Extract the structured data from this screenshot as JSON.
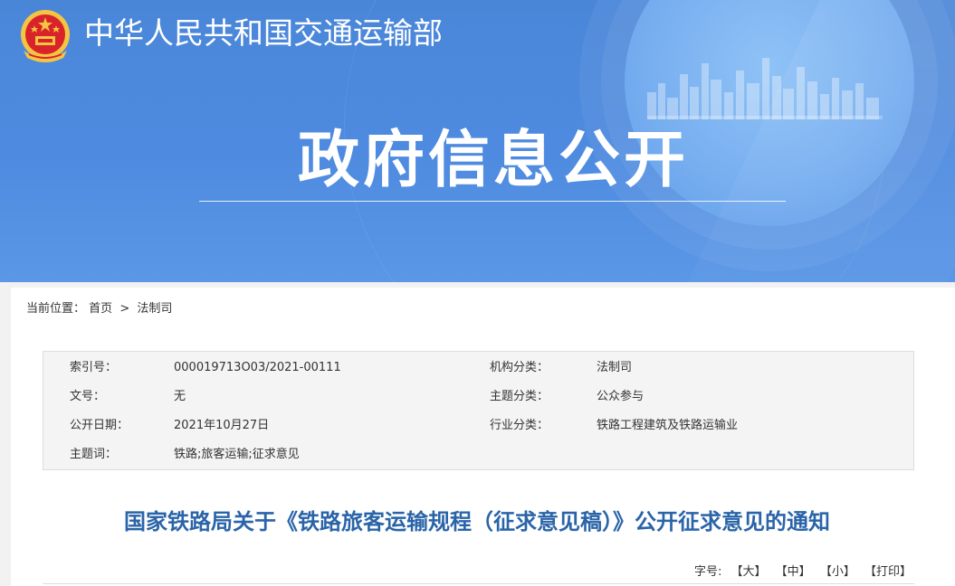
{
  "header": {
    "ministry_name": "中华人民共和国交通运输部",
    "banner_title": "政府信息公开",
    "emblem_icon": "national-emblem-icon"
  },
  "colors": {
    "banner_blue": "#4e8be0",
    "title_blue": "#2a64a8",
    "info_bg": "#f4f4f4"
  },
  "breadcrumb": {
    "prefix": "当前位置：",
    "items": [
      "首页",
      "法制司"
    ],
    "separator": ">"
  },
  "info": {
    "index_label": "索引号：",
    "index_value": "000019713O03/2021-00111",
    "doc_no_label": "文号：",
    "doc_no_value": "无",
    "pub_date_label": "公开日期：",
    "pub_date_value": "2021年10月27日",
    "keywords_label": "主题词：",
    "keywords_value": "铁路;旅客运输;征求意见",
    "org_label": "机构分类：",
    "org_value": "法制司",
    "topic_label": "主题分类：",
    "topic_value": "公众参与",
    "industry_label": "行业分类：",
    "industry_value": "铁路工程建筑及铁路运输业"
  },
  "document": {
    "title": "国家铁路局关于《铁路旅客运输规程（征求意见稿）》公开征求意见的通知"
  },
  "toolbar": {
    "font_label": "字号:",
    "large": "【大】",
    "medium": "【中】",
    "small": "【小】",
    "print": "【打印】"
  }
}
